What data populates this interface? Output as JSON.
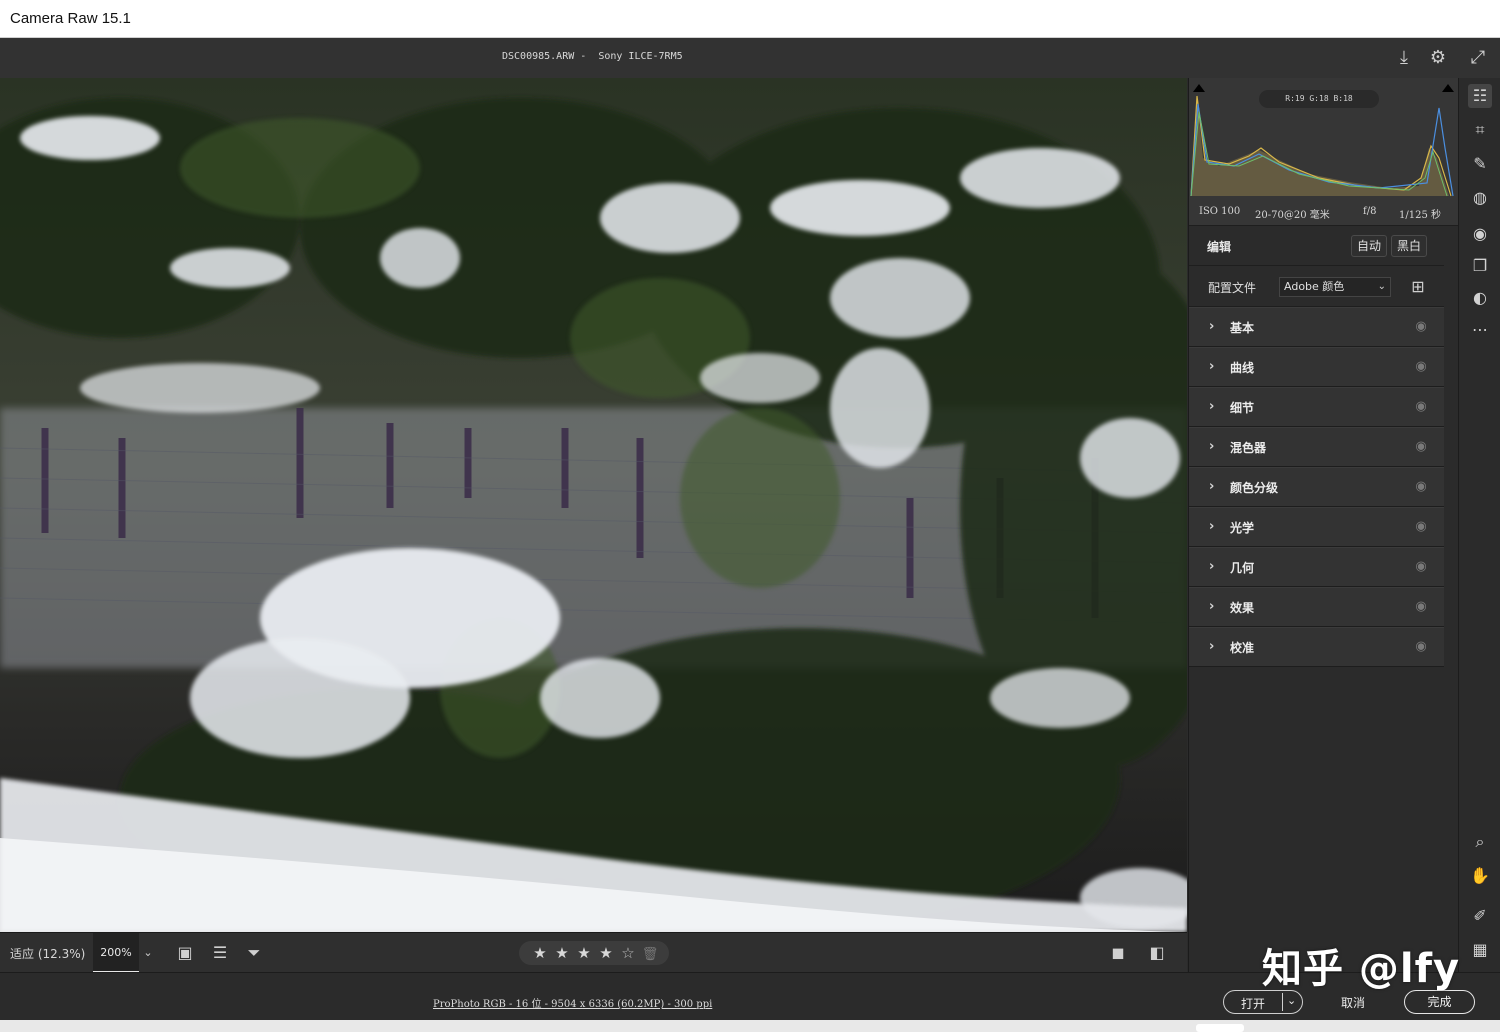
{
  "window": {
    "title": "Camera Raw 15.1"
  },
  "header": {
    "file_info": "DSC00985.ARW -  Sony ILCE-7RM5",
    "icons": [
      "save-icon",
      "gear-icon",
      "fullscreen-icon"
    ]
  },
  "histogram": {
    "rgb_readout": "R:19   G:18   B:18",
    "exif": {
      "iso": "ISO 100",
      "lens": "20-70@20 毫米",
      "aperture": "f/8",
      "shutter": "1/125 秒"
    }
  },
  "edit": {
    "label": "编辑",
    "auto_label": "自动",
    "bw_label": "黑白"
  },
  "profile": {
    "label": "配置文件",
    "value": "Adobe 颜色"
  },
  "sections": [
    {
      "label": "基本"
    },
    {
      "label": "曲线"
    },
    {
      "label": "细节"
    },
    {
      "label": "混色器"
    },
    {
      "label": "颜色分级"
    },
    {
      "label": "光学"
    },
    {
      "label": "几何"
    },
    {
      "label": "效果"
    },
    {
      "label": "校准"
    }
  ],
  "photobar": {
    "zoom_fit": "适应 (12.3%)",
    "zoom_pct": "200%",
    "rating": 4,
    "rating_max": 5
  },
  "bottombar": {
    "meta": "ProPhoto RGB - 16 位 - 9504 x 6336 (60.2MP) - 300 ppi",
    "open_label": "打开",
    "cancel_label": "取消",
    "done_label": "完成"
  },
  "watermark": "知乎 @lfy"
}
